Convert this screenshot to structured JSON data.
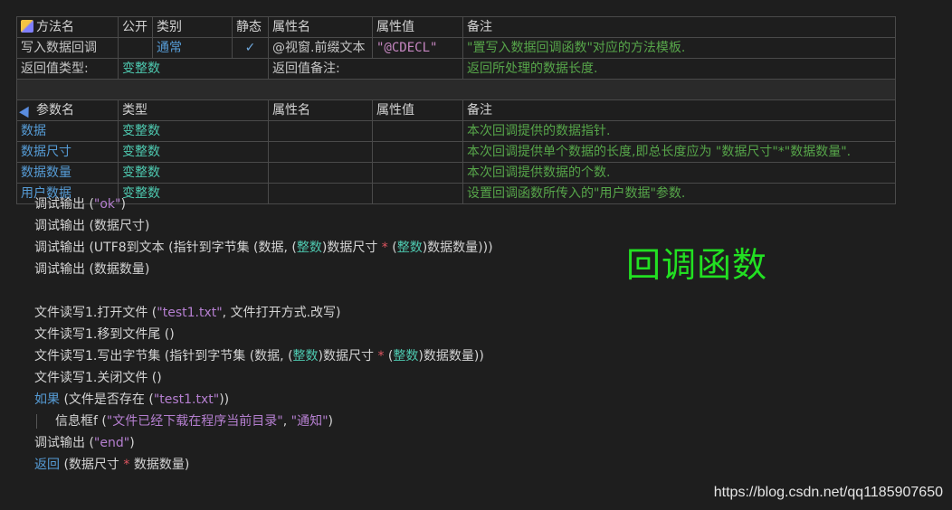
{
  "method_table": {
    "headers": [
      "方法名",
      "公开",
      "类别",
      "静态",
      "属性名",
      "属性值",
      "备注"
    ],
    "row": {
      "name": "写入数据回调",
      "public": "",
      "category": "通常",
      "static": "✓",
      "attr_name": "@视窗.前缀文本",
      "attr_value": "\"@CDECL\"",
      "note": "\"置写入数据回调函数\"对应的方法模板."
    },
    "return_type_label": "返回值类型:",
    "return_type": "变整数",
    "return_note_label": "返回值备注:",
    "return_note": "返回所处理的数据长度."
  },
  "param_table": {
    "headers": [
      "参数名",
      "类型",
      "属性名",
      "属性值",
      "备注"
    ],
    "rows": [
      {
        "name": "数据",
        "type": "变整数",
        "attr_name": "",
        "attr_value": "",
        "note": "本次回调提供的数据指针."
      },
      {
        "name": "数据尺寸",
        "type": "变整数",
        "attr_name": "",
        "attr_value": "",
        "note": "本次回调提供单个数据的长度,即总长度应为 \"数据尺寸\"*\"数据数量\"."
      },
      {
        "name": "数据数量",
        "type": "变整数",
        "attr_name": "",
        "attr_value": "",
        "note": "本次回调提供数据的个数."
      },
      {
        "name": "用户数据",
        "type": "变整数",
        "attr_name": "",
        "attr_value": "",
        "note": "设置回调函数所传入的\"用户数据\"参数."
      }
    ]
  },
  "code": {
    "l1_fn": "调试输出 (",
    "l1_str": "\"ok\"",
    "l1_end": ")",
    "l2": "调试输出 (数据尺寸)",
    "l3_a": "调试输出 (UTF8到文本 (指针到字节集 (数据, (",
    "l3_t1": "整数",
    "l3_b": ")数据尺寸 ",
    "l3_op": "*",
    "l3_c": " (",
    "l3_t2": "整数",
    "l3_d": ")数据数量)))",
    "l4": "调试输出 (数据数量)",
    "l6_a": "文件读写1.打开文件 (",
    "l6_str": "\"test1.txt\"",
    "l6_b": ", 文件打开方式.改写)",
    "l7": "文件读写1.移到文件尾 ()",
    "l8_a": "文件读写1.写出字节集 (指针到字节集 (数据, (",
    "l8_t1": "整数",
    "l8_b": ")数据尺寸 ",
    "l8_op": "*",
    "l8_c": " (",
    "l8_t2": "整数",
    "l8_d": ")数据数量))",
    "l9": "文件读写1.关闭文件 ()",
    "l10_kw": "如果",
    "l10_a": " (文件是否存在 (",
    "l10_str": "\"test1.txt\"",
    "l10_b": "))",
    "l11_a": "信息框f (",
    "l11_s1": "\"文件已经下载在程序当前目录\"",
    "l11_b": ", ",
    "l11_s2": "\"通知\"",
    "l11_c": ")",
    "l12_a": "调试输出 (",
    "l12_str": "\"end\"",
    "l12_b": ")",
    "l13_kw": "返回",
    "l13_a": " (数据尺寸 ",
    "l13_op": "*",
    "l13_b": " 数据数量)"
  },
  "big_title": "回调函数",
  "watermark": "https://blog.csdn.net/qq1185907650",
  "colors": {
    "background": "#1e1e1e",
    "keyword": "#569cd6",
    "type": "#4ec9b0",
    "note": "#57a64a",
    "string": "#b57fd0",
    "big_title": "#22e022"
  }
}
